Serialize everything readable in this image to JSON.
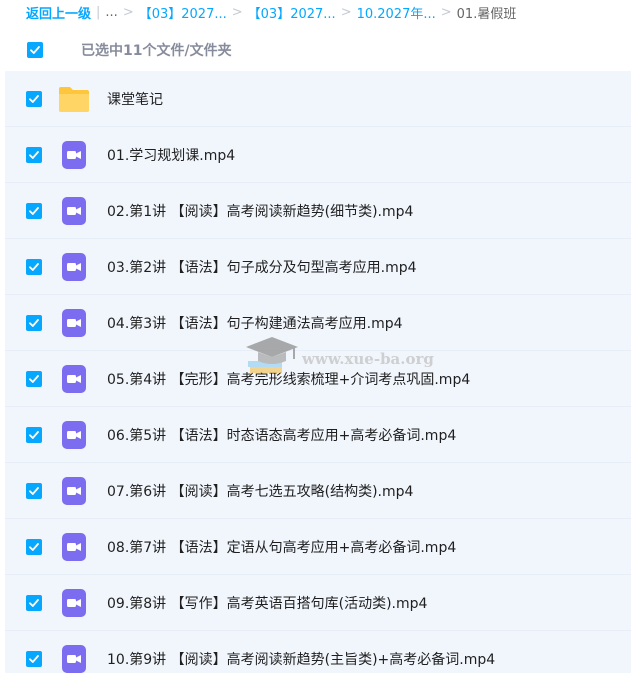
{
  "breadcrumb": {
    "back_label": "返回上一级",
    "ellipsis": "...",
    "items": [
      "【03】2027...",
      "【03】2027...",
      "10.2027年..."
    ],
    "current": "01.暑假班"
  },
  "selection": {
    "summary": "已选中11个文件/文件夹"
  },
  "files": [
    {
      "name": "课堂笔记",
      "type": "folder",
      "checked": true
    },
    {
      "name": "01.学习规划课.mp4",
      "type": "video",
      "checked": true
    },
    {
      "name": "02.第1讲 【阅读】高考阅读新趋势(细节类).mp4",
      "type": "video",
      "checked": true
    },
    {
      "name": "03.第2讲 【语法】句子成分及句型高考应用.mp4",
      "type": "video",
      "checked": true
    },
    {
      "name": "04.第3讲 【语法】句子构建通法高考应用.mp4",
      "type": "video",
      "checked": true
    },
    {
      "name": "05.第4讲 【完形】高考完形线索梳理+介词考点巩固.mp4",
      "type": "video",
      "checked": true
    },
    {
      "name": "06.第5讲 【语法】时态语态高考应用+高考必备词.mp4",
      "type": "video",
      "checked": true
    },
    {
      "name": "07.第6讲 【阅读】高考七选五攻略(结构类).mp4",
      "type": "video",
      "checked": true
    },
    {
      "name": "08.第7讲 【语法】定语从句高考应用+高考必备词.mp4",
      "type": "video",
      "checked": true
    },
    {
      "name": "09.第8讲 【写作】高考英语百搭句库(活动类).mp4",
      "type": "video",
      "checked": true
    },
    {
      "name": "10.第9讲 【阅读】高考阅读新趋势(主旨类)+高考必备词.mp4",
      "type": "video",
      "checked": true
    }
  ],
  "watermark": {
    "text": "www.xue-ba.org"
  },
  "colors": {
    "accent": "#06a7ff",
    "row_bg": "#f1f6fd",
    "folder": "#ffc53d",
    "video": "#7b6cf0"
  }
}
